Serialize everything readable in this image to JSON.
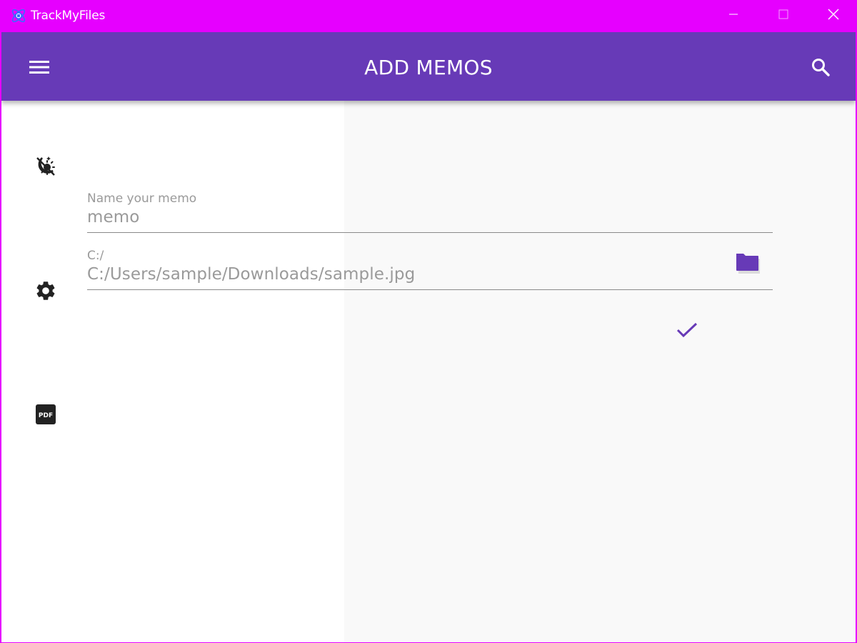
{
  "window": {
    "title": "TrackMyFiles",
    "accent_color": "#e600ff"
  },
  "titlebar_controls": {
    "minimize_icon": "minimize-icon",
    "maximize_icon": "maximize-icon",
    "close_icon": "close-icon"
  },
  "appbar": {
    "title": "ADD MEMOS",
    "background_color": "#673ab7",
    "menu_icon": "hamburger-menu-icon",
    "search_icon": "search-icon"
  },
  "sidebar": {
    "items": [
      {
        "icon": "theme-toggle-icon"
      },
      {
        "icon": "gear-icon"
      },
      {
        "icon": "pdf-icon"
      }
    ]
  },
  "form": {
    "memo_name": {
      "label": "Name your memo",
      "value": "memo"
    },
    "file_path": {
      "label": "C:/",
      "value": "C:/Users/sample/Downloads/sample.jpg",
      "browse_icon": "folder-icon"
    },
    "confirm_icon": "checkmark-icon"
  }
}
